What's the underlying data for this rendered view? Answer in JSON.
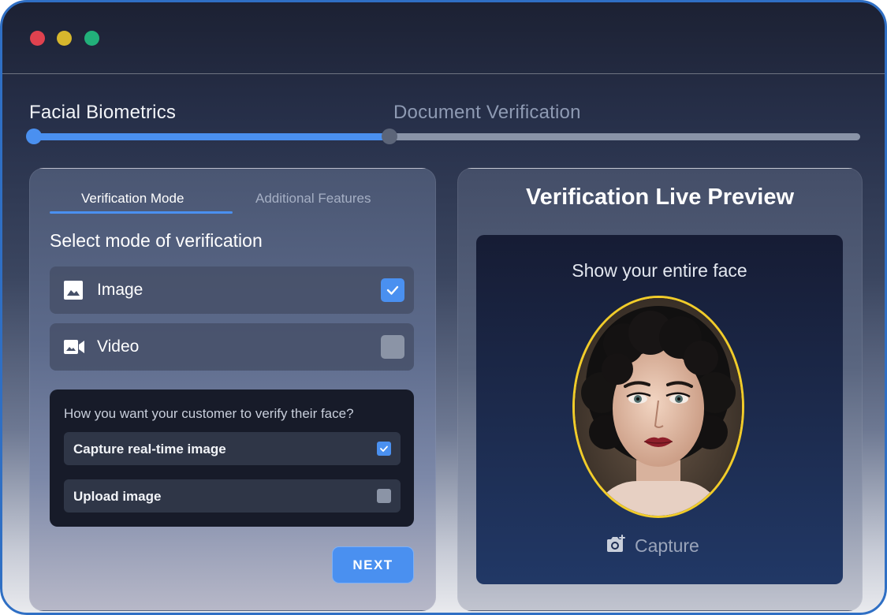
{
  "window": {
    "controls": [
      "close",
      "minimize",
      "maximize"
    ]
  },
  "stepper": {
    "steps": [
      {
        "label": "Facial Biometrics",
        "state": "active"
      },
      {
        "label": "Document Verification",
        "state": "pending"
      }
    ],
    "progress": 0.43
  },
  "left_panel": {
    "tabs": [
      {
        "label": "Verification Mode",
        "active": true
      },
      {
        "label": "Additional Features",
        "active": false
      }
    ],
    "section_title": "Select mode of verification",
    "modes": [
      {
        "label": "Image",
        "icon": "image-icon",
        "checked": true
      },
      {
        "label": "Video",
        "icon": "video-camera-icon",
        "checked": false
      }
    ],
    "sub_card": {
      "question": "How you want your customer to verify their face?",
      "options": [
        {
          "label": "Capture real-time image",
          "checked": true
        },
        {
          "label": "Upload image",
          "checked": false
        }
      ]
    },
    "next_label": "NEXT"
  },
  "right_panel": {
    "title": "Verification Live Preview",
    "instruction": "Show your entire face",
    "capture_label": "Capture",
    "capture_icon": "add-photo-camera-icon"
  },
  "colors": {
    "accent": "#4a90f0",
    "face_frame": "#f1cc2a",
    "window_border": "#2f6fc4"
  }
}
